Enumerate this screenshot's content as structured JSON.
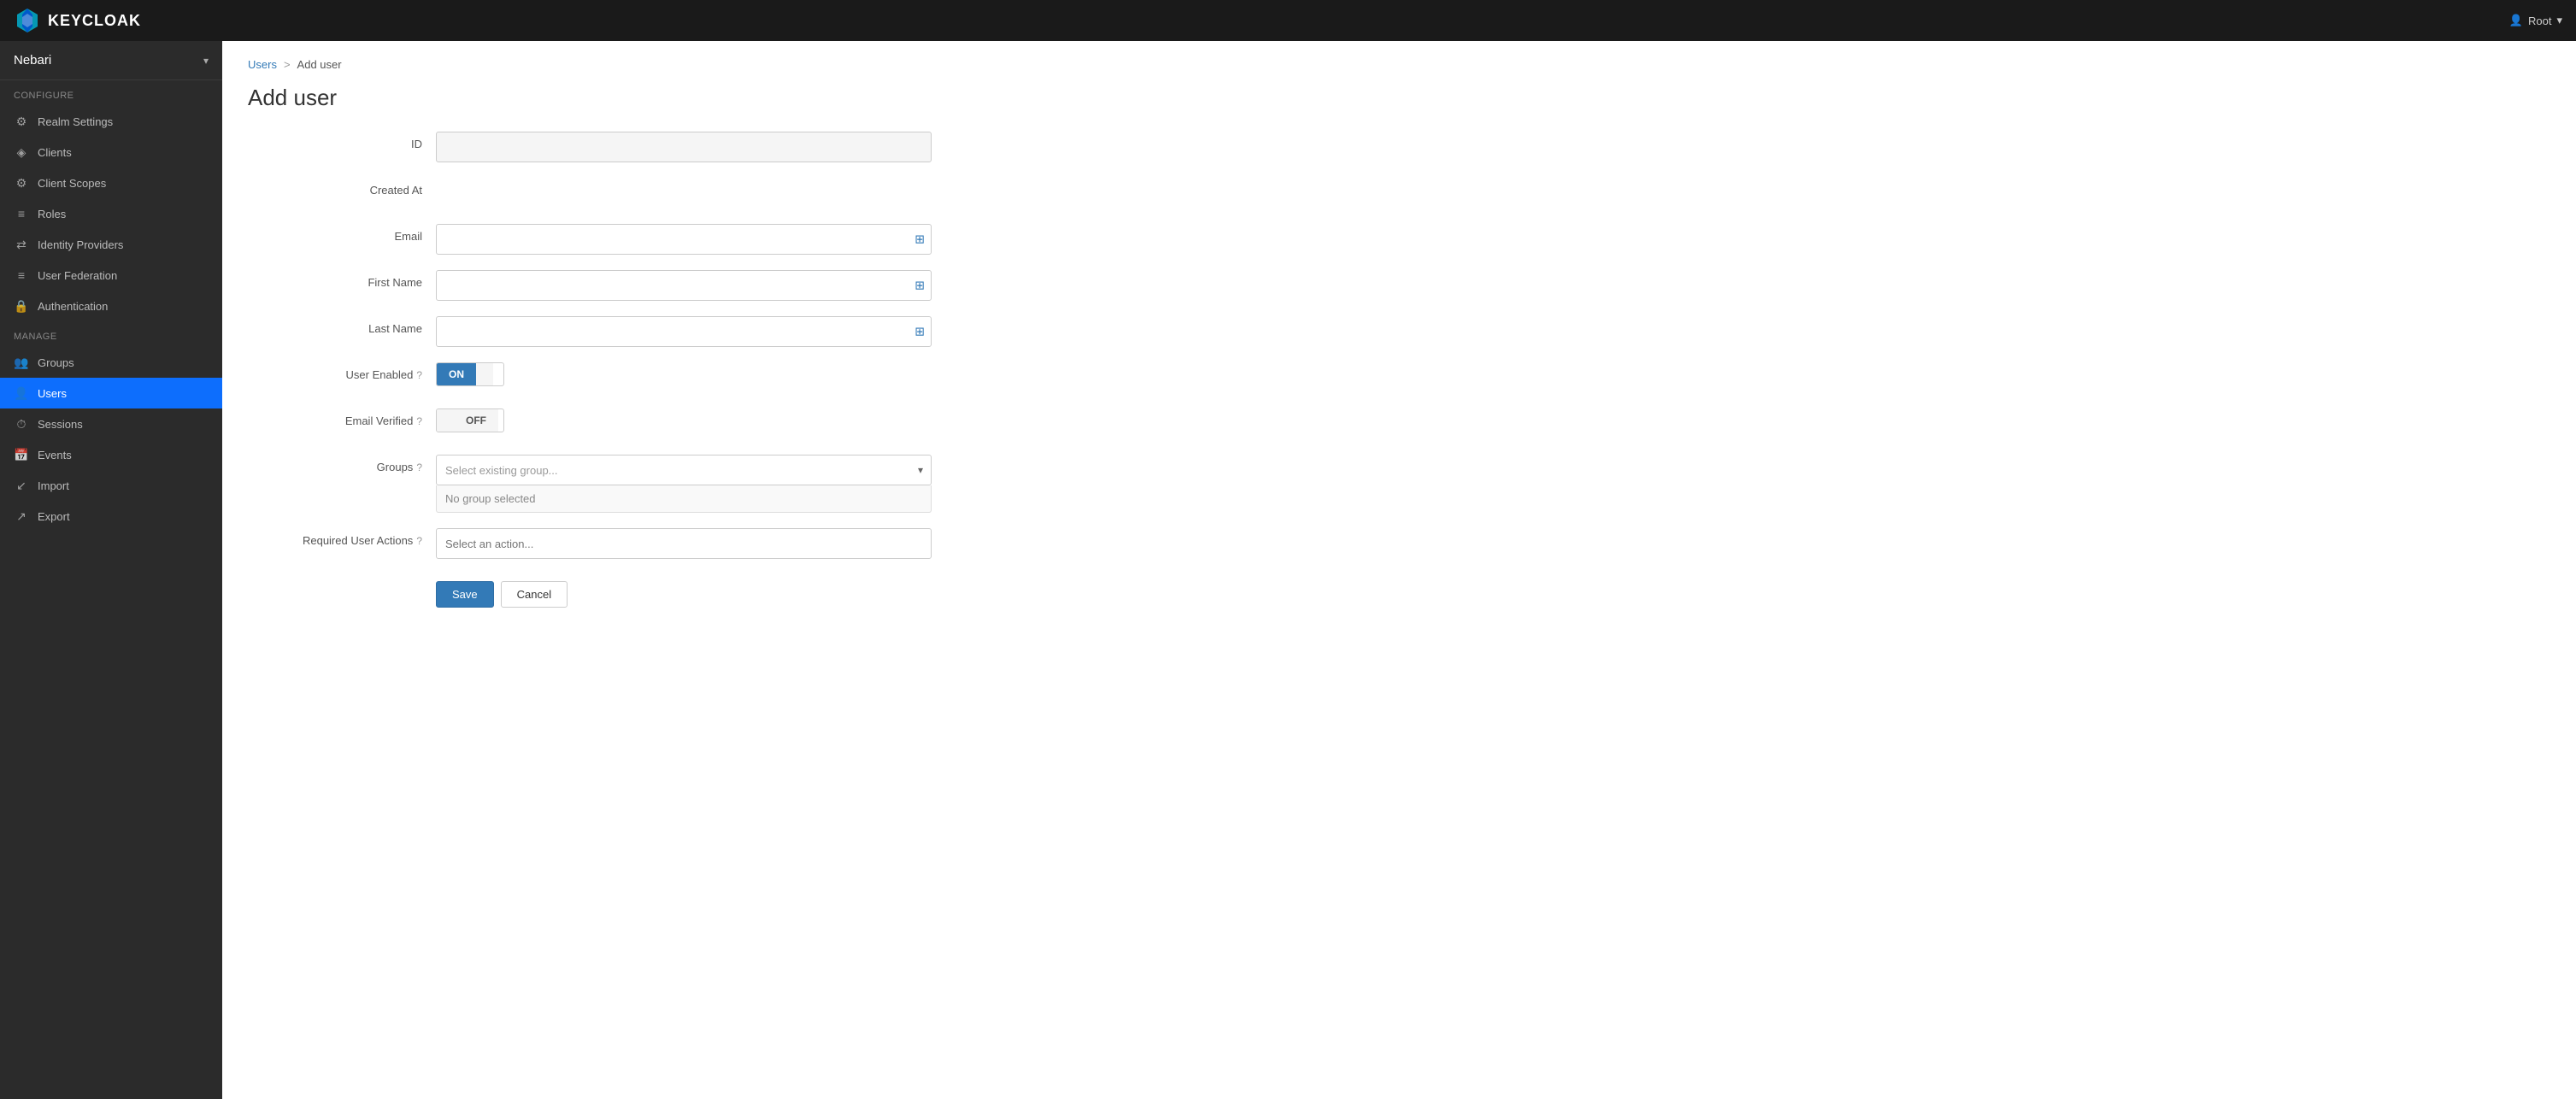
{
  "navbar": {
    "brand": "KEYCLOAK",
    "user_label": "Root",
    "chevron": "▾"
  },
  "sidebar": {
    "realm_name": "Nebari",
    "realm_chevron": "▾",
    "configure_label": "Configure",
    "configure_items": [
      {
        "id": "realm-settings",
        "label": "Realm Settings",
        "icon": "⚙"
      },
      {
        "id": "clients",
        "label": "Clients",
        "icon": "◈"
      },
      {
        "id": "client-scopes",
        "label": "Client Scopes",
        "icon": "⚙"
      },
      {
        "id": "roles",
        "label": "Roles",
        "icon": "≡"
      },
      {
        "id": "identity-providers",
        "label": "Identity Providers",
        "icon": "⇄"
      },
      {
        "id": "user-federation",
        "label": "User Federation",
        "icon": "≡"
      },
      {
        "id": "authentication",
        "label": "Authentication",
        "icon": "🔒"
      }
    ],
    "manage_label": "Manage",
    "manage_items": [
      {
        "id": "groups",
        "label": "Groups",
        "icon": "👥"
      },
      {
        "id": "users",
        "label": "Users",
        "icon": "👤",
        "active": true
      },
      {
        "id": "sessions",
        "label": "Sessions",
        "icon": "⏱"
      },
      {
        "id": "events",
        "label": "Events",
        "icon": "📅"
      },
      {
        "id": "import",
        "label": "Import",
        "icon": "↙"
      },
      {
        "id": "export",
        "label": "Export",
        "icon": "↗"
      }
    ]
  },
  "breadcrumb": {
    "parent_label": "Users",
    "separator": ">",
    "current_label": "Add user"
  },
  "page": {
    "title": "Add user"
  },
  "form": {
    "id_label": "ID",
    "id_placeholder": "",
    "created_at_label": "Created At",
    "email_label": "Email",
    "email_placeholder": "",
    "first_name_label": "First Name",
    "first_name_placeholder": "",
    "last_name_label": "Last Name",
    "last_name_placeholder": "",
    "user_enabled_label": "User Enabled",
    "toggle_on": "ON",
    "toggle_off": "OFF",
    "email_verified_label": "Email Verified",
    "groups_label": "Groups",
    "groups_placeholder": "Select existing group...",
    "groups_no_selection": "No group selected",
    "required_actions_label": "Required User Actions",
    "required_actions_placeholder": "Select an action...",
    "save_button": "Save",
    "cancel_button": "Cancel"
  }
}
